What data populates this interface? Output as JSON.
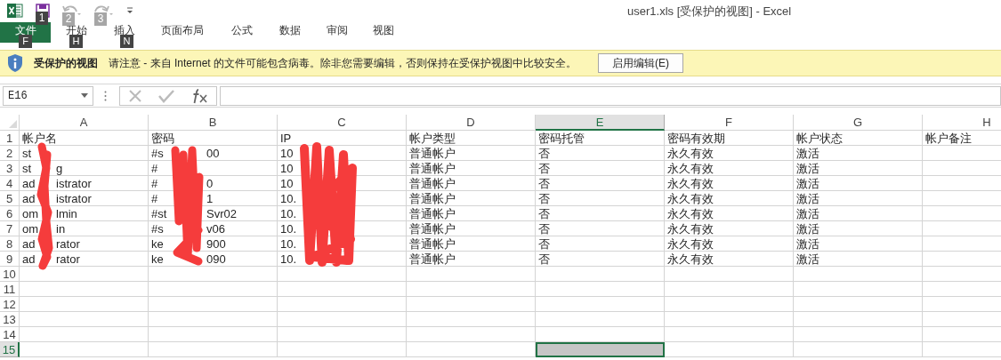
{
  "window": {
    "title": "user1.xls  [受保护的视图] - Excel"
  },
  "quick_access": [
    {
      "kind": "save",
      "key_tip": "1",
      "disabled": false
    },
    {
      "kind": "undo",
      "key_tip": "2",
      "disabled": true
    },
    {
      "kind": "redo",
      "key_tip": "3",
      "disabled": true
    }
  ],
  "ribbon_tabs": [
    {
      "label": "文件",
      "kind": "file",
      "key_tip": "F"
    },
    {
      "label": "开始",
      "kind": "tab",
      "key_tip": "H"
    },
    {
      "label": "插入",
      "kind": "tab",
      "key_tip": "N"
    },
    {
      "label": "页面布局",
      "kind": "tab"
    },
    {
      "label": "公式",
      "kind": "tab"
    },
    {
      "label": "数据",
      "kind": "tab"
    },
    {
      "label": "审阅",
      "kind": "tab"
    },
    {
      "label": "视图",
      "kind": "tab"
    }
  ],
  "message_bar": {
    "title": "受保护的视图",
    "text": "请注意 - 来自 Internet 的文件可能包含病毒。除非您需要编辑，否则保持在受保护视图中比较安全。",
    "button": "启用编辑(E)"
  },
  "formula_bar": {
    "name_box": "E16"
  },
  "sheet": {
    "columns": [
      {
        "label": "A",
        "selected": false
      },
      {
        "label": "B",
        "selected": false
      },
      {
        "label": "C",
        "selected": false
      },
      {
        "label": "D",
        "selected": false
      },
      {
        "label": "E",
        "selected": true
      },
      {
        "label": "F",
        "selected": false
      },
      {
        "label": "G",
        "selected": false
      },
      {
        "label": "H",
        "selected": false
      }
    ],
    "rows": [
      {
        "number": "1",
        "selected": false,
        "cells": [
          {
            "kind": "plain",
            "text": "帐户名"
          },
          {
            "kind": "plain",
            "text": "密码"
          },
          {
            "kind": "plain",
            "text": "IP"
          },
          {
            "kind": "plain",
            "text": "帐户类型"
          },
          {
            "kind": "plain",
            "text": "密码托管"
          },
          {
            "kind": "plain",
            "text": "密码有效期"
          },
          {
            "kind": "plain",
            "text": "帐户状态"
          },
          {
            "kind": "plain",
            "text": "帐户备注"
          }
        ]
      },
      {
        "number": "2",
        "selected": false,
        "cells": [
          {
            "kind": "redacted",
            "text": "st"
          },
          {
            "kind": "redacted",
            "text": "#s",
            "tail": "00"
          },
          {
            "kind": "redacted",
            "text": "10"
          },
          {
            "kind": "plain",
            "text": "普通帐户"
          },
          {
            "kind": "plain",
            "text": "否"
          },
          {
            "kind": "plain",
            "text": "永久有效"
          },
          {
            "kind": "plain",
            "text": "激活"
          }
        ]
      },
      {
        "number": "3",
        "selected": false,
        "cells": [
          {
            "kind": "redacted",
            "text": "st",
            "tail": "g"
          },
          {
            "kind": "redacted",
            "text": "#"
          },
          {
            "kind": "redacted",
            "text": "10"
          },
          {
            "kind": "plain",
            "text": "普通帐户"
          },
          {
            "kind": "plain",
            "text": "否"
          },
          {
            "kind": "plain",
            "text": "永久有效"
          },
          {
            "kind": "plain",
            "text": "激活"
          }
        ]
      },
      {
        "number": "4",
        "selected": false,
        "cells": [
          {
            "kind": "redacted",
            "text": "ad",
            "tail": "istrator"
          },
          {
            "kind": "redacted",
            "text": "#",
            "tail": "0"
          },
          {
            "kind": "redacted",
            "text": "10"
          },
          {
            "kind": "plain",
            "text": "普通帐户"
          },
          {
            "kind": "plain",
            "text": "否"
          },
          {
            "kind": "plain",
            "text": "永久有效"
          },
          {
            "kind": "plain",
            "text": "激活"
          }
        ]
      },
      {
        "number": "5",
        "selected": false,
        "cells": [
          {
            "kind": "redacted",
            "text": "ad",
            "tail": "istrator"
          },
          {
            "kind": "redacted",
            "text": "#",
            "tail": "1"
          },
          {
            "kind": "redacted",
            "text": "10."
          },
          {
            "kind": "plain",
            "text": "普通帐户"
          },
          {
            "kind": "plain",
            "text": "否"
          },
          {
            "kind": "plain",
            "text": "永久有效"
          },
          {
            "kind": "plain",
            "text": "激活"
          }
        ]
      },
      {
        "number": "6",
        "selected": false,
        "cells": [
          {
            "kind": "redacted",
            "text": "om",
            "tail": "lmin"
          },
          {
            "kind": "redacted",
            "text": "#st",
            "tail": "Svr02"
          },
          {
            "kind": "redacted",
            "text": "10."
          },
          {
            "kind": "plain",
            "text": "普通帐户"
          },
          {
            "kind": "plain",
            "text": "否"
          },
          {
            "kind": "plain",
            "text": "永久有效"
          },
          {
            "kind": "plain",
            "text": "激活"
          }
        ]
      },
      {
        "number": "7",
        "selected": false,
        "cells": [
          {
            "kind": "redacted",
            "text": "om",
            "tail": "in"
          },
          {
            "kind": "redacted",
            "text": "#s",
            "tail": "v06"
          },
          {
            "kind": "redacted",
            "text": "10."
          },
          {
            "kind": "plain",
            "text": "普通帐户"
          },
          {
            "kind": "plain",
            "text": "否"
          },
          {
            "kind": "plain",
            "text": "永久有效"
          },
          {
            "kind": "plain",
            "text": "激活"
          }
        ]
      },
      {
        "number": "8",
        "selected": false,
        "cells": [
          {
            "kind": "redacted",
            "text": "ad",
            "tail": "rator"
          },
          {
            "kind": "redacted",
            "text": "ke",
            "tail": "900"
          },
          {
            "kind": "redacted",
            "text": "10."
          },
          {
            "kind": "plain",
            "text": "普通帐户"
          },
          {
            "kind": "plain",
            "text": "否"
          },
          {
            "kind": "plain",
            "text": "永久有效"
          },
          {
            "kind": "plain",
            "text": "激活"
          }
        ]
      },
      {
        "number": "9",
        "selected": false,
        "cells": [
          {
            "kind": "redacted",
            "text": "ad",
            "tail": "rator"
          },
          {
            "kind": "redacted",
            "text": "ke",
            "tail": "090"
          },
          {
            "kind": "redacted",
            "text": "10."
          },
          {
            "kind": "plain",
            "text": "普通帐户"
          },
          {
            "kind": "plain",
            "text": "否"
          },
          {
            "kind": "plain",
            "text": "永久有效"
          },
          {
            "kind": "plain",
            "text": "激活"
          }
        ]
      },
      {
        "number": "10",
        "selected": false
      },
      {
        "number": "11",
        "selected": false
      },
      {
        "number": "12",
        "selected": false
      },
      {
        "number": "13",
        "selected": false
      },
      {
        "number": "14",
        "selected": false
      },
      {
        "number": "15",
        "selected": true
      }
    ]
  }
}
